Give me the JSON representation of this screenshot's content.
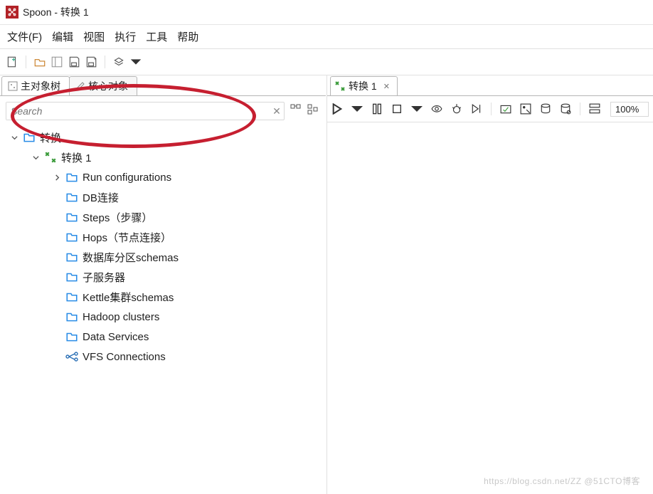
{
  "window": {
    "title": "Spoon - 转换 1"
  },
  "menu": {
    "file": "文件(F)",
    "edit": "编辑",
    "view": "视图",
    "run": "执行",
    "tools": "工具",
    "help": "帮助"
  },
  "left": {
    "tabs": {
      "objectTree": "主对象树",
      "core": "核心对象"
    },
    "search": {
      "placeholder": "Search"
    },
    "tree": {
      "root": {
        "label": "转换"
      },
      "trans": {
        "label": "转换 1"
      },
      "children": [
        {
          "id": "runconf",
          "label": "Run configurations",
          "expandable": true
        },
        {
          "id": "dbconn",
          "label": "DB连接"
        },
        {
          "id": "steps",
          "label": "Steps（步骤）"
        },
        {
          "id": "hops",
          "label": "Hops（节点连接）"
        },
        {
          "id": "dbpart",
          "label": "数据库分区schemas"
        },
        {
          "id": "subsrv",
          "label": "子服务器"
        },
        {
          "id": "kcluster",
          "label": "Kettle集群schemas"
        },
        {
          "id": "hadoop",
          "label": "Hadoop clusters"
        },
        {
          "id": "datasvc",
          "label": "Data Services"
        },
        {
          "id": "vfs",
          "label": "VFS Connections",
          "icon": "vfs"
        }
      ]
    }
  },
  "right": {
    "tab": {
      "label": "转换 1"
    },
    "zoom": "100%"
  },
  "watermark": "https://blog.csdn.net/ZZ @51CTO博客"
}
